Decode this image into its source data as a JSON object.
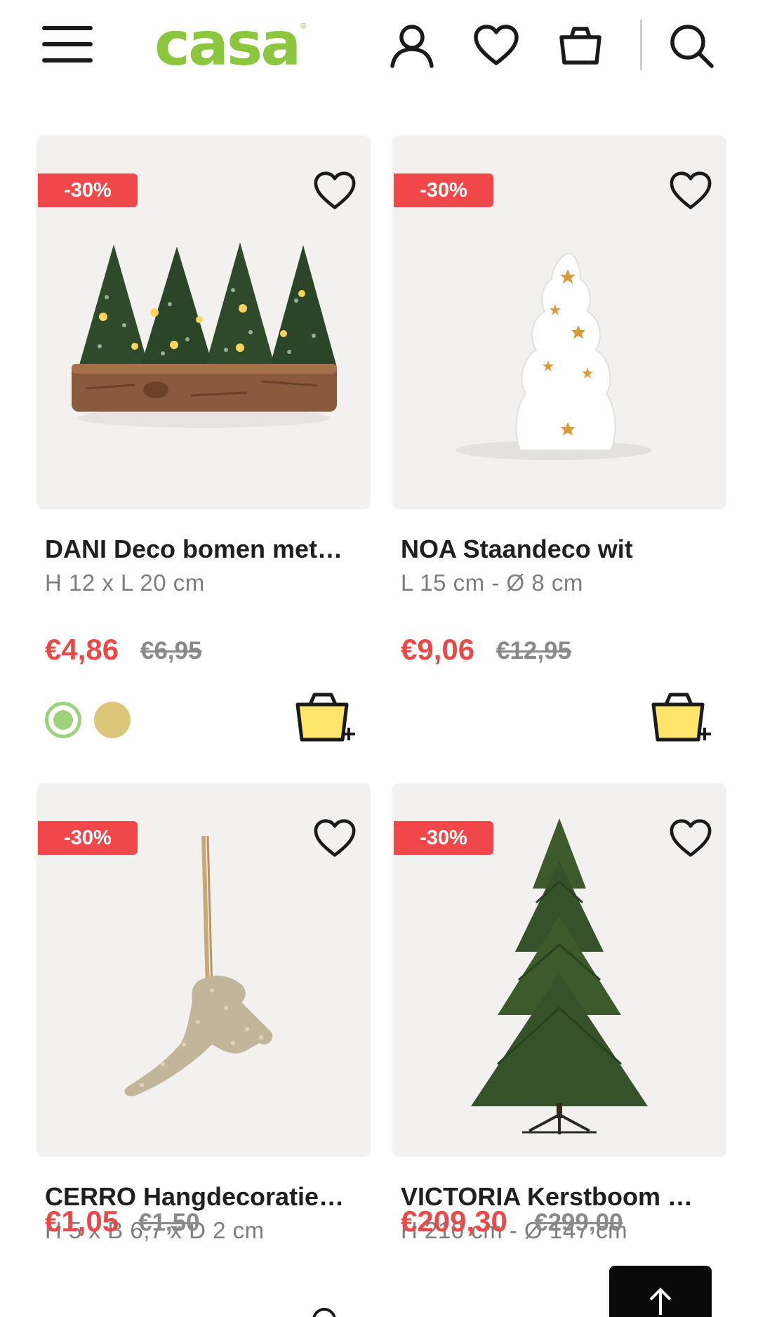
{
  "header": {
    "logo_text": "casa",
    "logo_reg": "®",
    "icons": [
      "menu-icon",
      "user-icon",
      "heart-icon",
      "shopping-bag-icon",
      "search-icon"
    ],
    "brand_color": "#8cc63f"
  },
  "products": [
    {
      "badge": "-30%",
      "title": "DANI Deco bomen met…",
      "dims": "H 12 x L 20 cm",
      "price": "€4,86",
      "old_price": "€6,95",
      "swatches": [
        "#9fd07a",
        "#dcc67a"
      ]
    },
    {
      "badge": "-30%",
      "title": "NOA Staandeco wit",
      "dims": "L 15 cm - Ø 8 cm",
      "price": "€9,06",
      "old_price": "€12,95"
    },
    {
      "badge": "-30%",
      "title": "CERRO Hangdecoratie…",
      "dims": "H 5 x B 6,7 x D 2 cm",
      "price": "€1,05",
      "old_price": "€1,50"
    },
    {
      "badge": "-30%",
      "title": "VICTORIA Kerstboom …",
      "dims": "H 210 cm - Ø 147 cm",
      "price": "€209,30",
      "old_price": "€299,00"
    }
  ],
  "colors": {
    "discount_badge": "#f0484a",
    "sale_price": "#e84a4a",
    "cart_yellow": "#fde56b"
  },
  "back_to_top_icon": "arrow-up-icon"
}
